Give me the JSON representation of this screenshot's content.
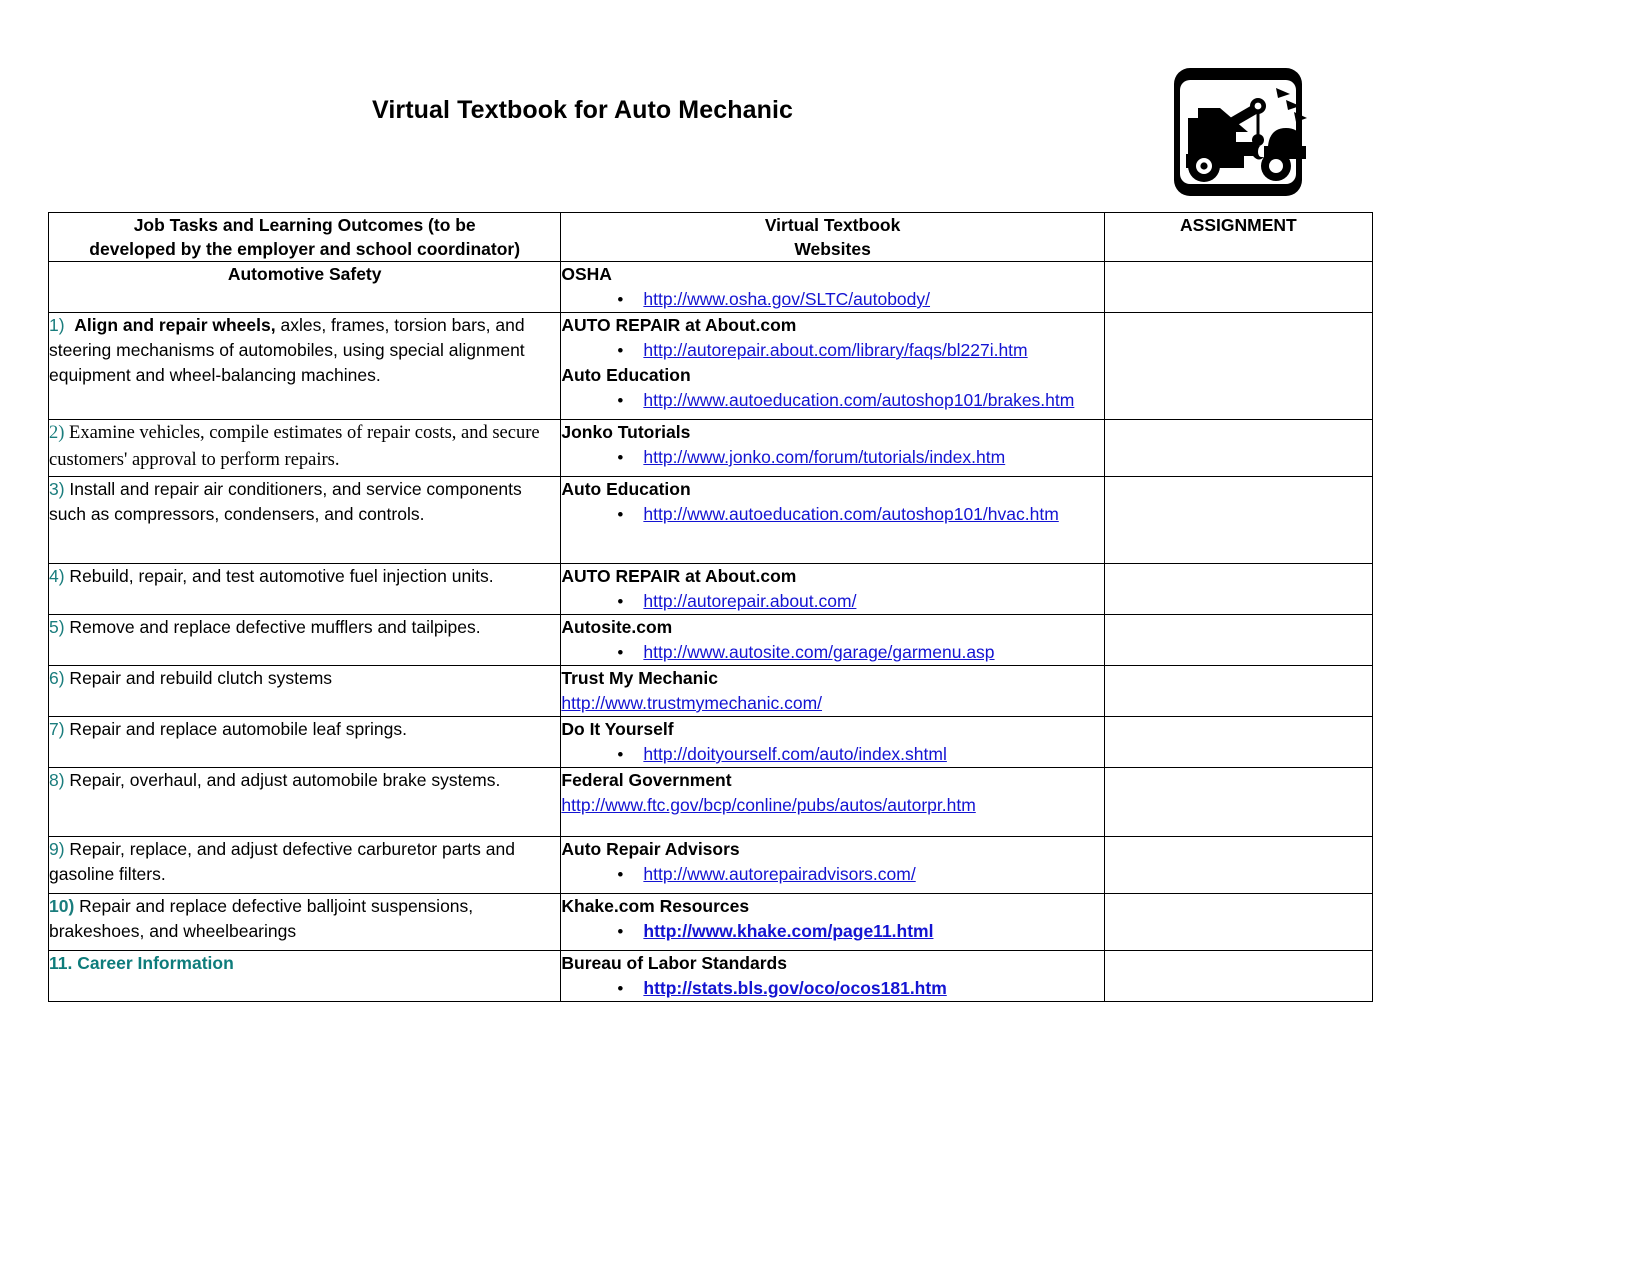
{
  "document": {
    "title": "Virtual Textbook for Auto Mechanic",
    "logo_icon": "tow-truck-icon"
  },
  "table": {
    "headers": {
      "col1_line1": "Job Tasks and Learning Outcomes (to be",
      "col1_line2": "developed by the employer and school coordinator)",
      "col2_line1": "Virtual Textbook",
      "col2_line2": "Websites",
      "col3": "ASSIGNMENT"
    },
    "rows": [
      {
        "num": "",
        "task_text": "Automotive Safety",
        "style": "centered-bold",
        "site": "OSHA",
        "links": [
          {
            "text": "http://www.osha.gov/SLTC/autobody/",
            "bold": false,
            "bulleted": true
          }
        ],
        "assignment": ""
      },
      {
        "num": "1)",
        "task_bold": "Align and repair wheels,",
        "task_text": " axles, frames, torsion bars, and steering mechanisms of automobiles, using special alignment equipment and wheel-balancing machines.",
        "style": "sans",
        "site": "AUTO REPAIR at About.com",
        "site2": "Auto Education",
        "links": [
          {
            "text": "http://autorepair.about.com/library/faqs/bl227i.htm",
            "bold": false,
            "bulleted": true
          }
        ],
        "links2": [
          {
            "text": "http://www.autoeducation.com/autoshop101/brakes.htm",
            "bold": false,
            "bulleted": true
          }
        ],
        "assignment": ""
      },
      {
        "num": "2)",
        "task_text": " Examine vehicles, compile estimates of repair costs, and secure customers' approval to perform repairs.",
        "style": "serif",
        "site": "Jonko Tutorials",
        "links": [
          {
            "text": "http://www.jonko.com/forum/tutorials/index.htm",
            "bold": false,
            "bulleted": true
          }
        ],
        "assignment": ""
      },
      {
        "num": "3)",
        "task_text": " Install and repair air conditioners, and service components such as compressors, condensers, and controls.",
        "style": "sans",
        "site": "Auto Education",
        "links": [
          {
            "text": "http://www.autoeducation.com/autoshop101/hvac.htm",
            "bold": false,
            "bulleted": true
          }
        ],
        "assignment": ""
      },
      {
        "num": "4)",
        "task_text": " Rebuild, repair, and test automotive fuel injection units.",
        "style": "sans",
        "site": "AUTO REPAIR at About.com",
        "links": [
          {
            "text": "http://autorepair.about.com/",
            "bold": false,
            "bulleted": true
          }
        ],
        "assignment": ""
      },
      {
        "num": "5)",
        "task_text": " Remove and replace defective mufflers and tailpipes.",
        "style": "sans",
        "site": "Autosite.com",
        "links": [
          {
            "text": "http://www.autosite.com/garage/garmenu.asp",
            "bold": false,
            "bulleted": true
          }
        ],
        "assignment": ""
      },
      {
        "num": "6)",
        "task_text": " Repair and rebuild clutch systems",
        "style": "sans",
        "site": "Trust My Mechanic",
        "links": [
          {
            "text": "http://www.trustmymechanic.com/",
            "bold": false,
            "bulleted": false
          }
        ],
        "assignment": ""
      },
      {
        "num": "7)",
        "task_text": " Repair and replace automobile leaf springs.",
        "style": "sans",
        "site": "Do It Yourself",
        "links": [
          {
            "text": "http://doityourself.com/auto/index.shtml",
            "bold": false,
            "bulleted": true
          }
        ],
        "assignment": ""
      },
      {
        "num": "8)",
        "task_text": " Repair, overhaul, and adjust automobile brake systems.",
        "style": "sans",
        "site": "Federal Government",
        "links": [
          {
            "text": "http://www.ftc.gov/bcp/conline/pubs/autos/autorpr.htm",
            "bold": false,
            "bulleted": false
          }
        ],
        "assignment": ""
      },
      {
        "num": "9)",
        "task_text": " Repair, replace, and adjust defective carburetor parts and gasoline filters.",
        "style": "sans",
        "site": "Auto Repair Advisors",
        "links": [
          {
            "text": "http://www.autorepairadvisors.com/",
            "bold": false,
            "bulleted": true
          }
        ],
        "assignment": ""
      },
      {
        "num": "10)",
        "task_text": "  Repair and replace defective balljoint suspensions, brakeshoes, and wheelbearings",
        "style": "sans-numbold",
        "site": "Khake.com Resources",
        "links": [
          {
            "text": "http://www.khake.com/page11.html",
            "bold": true,
            "bulleted": true
          }
        ],
        "assignment": ""
      },
      {
        "num": "11.",
        "task_text": "  Career Information",
        "style": "teal-bold",
        "site": "Bureau of Labor Standards",
        "links": [
          {
            "text": "http://stats.bls.gov/oco/ocos181.htm",
            "bold": true,
            "bulleted": true
          }
        ],
        "assignment": ""
      }
    ]
  },
  "colors": {
    "link": "#1414d2",
    "number_accent": "#1a7d7d",
    "teal_heading": "#0e7c7b",
    "border": "#000000"
  }
}
